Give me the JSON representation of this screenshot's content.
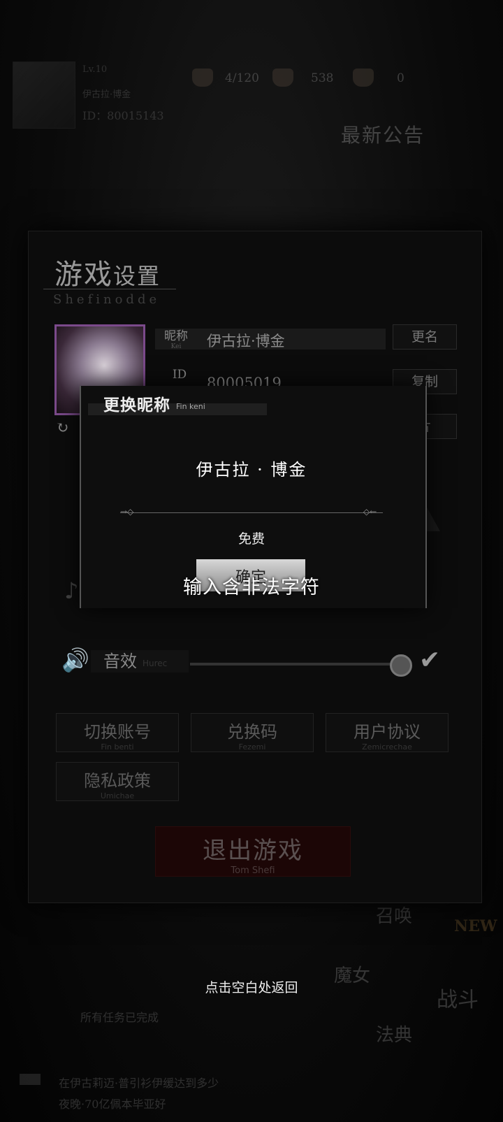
{
  "hud": {
    "player_name": "伊古拉·博金",
    "player_id_line": "ID：80015143",
    "level": "Lv.10",
    "stamina": "4/120",
    "gems": "538",
    "other": "0",
    "notice_title": "最新公告",
    "side_buttons": [
      "召唤",
      "魔女",
      "法典"
    ],
    "battle_label": "战斗",
    "new_badge": "NEW",
    "task_text": "所有任务已完成",
    "ticker_line1": "在伊古莉迈·普引衫伊缓达到多少",
    "ticker_line2": "夜晚·70亿佩本毕亚好"
  },
  "settings": {
    "title_big": "游戏",
    "title_small": "设置",
    "subtitle": "Shefinodde",
    "nickname_label": "昵称",
    "nickname_label_sub": "Kei",
    "nickname_value": "伊古拉·博金",
    "rename_button": "更名",
    "id_label": "ID",
    "id_value": "80005019",
    "copy_button": "复制",
    "card_button": "片",
    "sfx_label": "音效",
    "sfx_sub": "Hurec",
    "music_label": "音乐",
    "buttons": [
      {
        "label": "切换账号",
        "sub": "Fin benti"
      },
      {
        "label": "兑换码",
        "sub": "Fezemi"
      },
      {
        "label": "用户协议",
        "sub": "Zemicrechae"
      },
      {
        "label": "隐私政策",
        "sub": "Umichae"
      }
    ],
    "exit_label": "退出游戏",
    "exit_sub": "Tom Shefi"
  },
  "modal": {
    "title": "更换昵称",
    "title_sub": "Fin keni",
    "name_value": "伊古拉 · 博金",
    "cost": "免费",
    "confirm": "确定",
    "toast": "输入含非法字符"
  },
  "back_hint": "点击空白处返回"
}
